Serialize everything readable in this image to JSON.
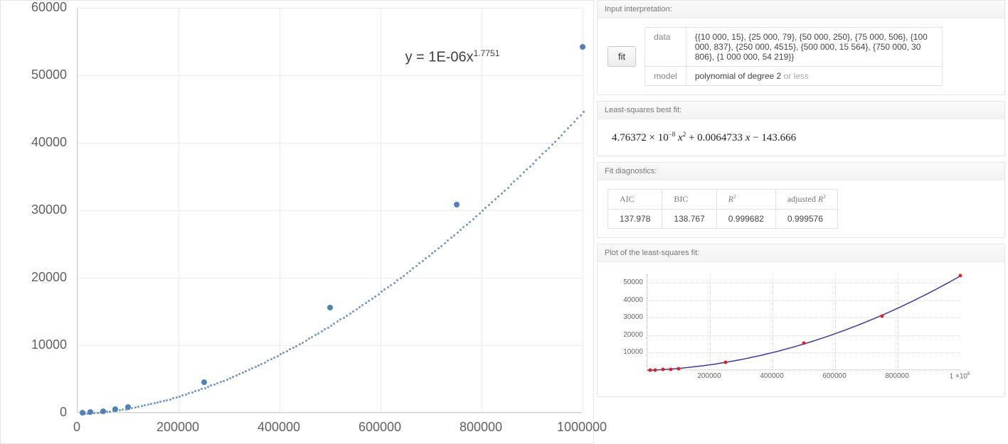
{
  "chart_data": {
    "type": "scatter",
    "title": "",
    "xlabel": "",
    "ylabel": "",
    "xlim": [
      0,
      1000000
    ],
    "ylim": [
      0,
      60000
    ],
    "x_ticks": [
      0,
      200000,
      400000,
      600000,
      800000,
      1000000
    ],
    "y_ticks": [
      0,
      10000,
      20000,
      30000,
      40000,
      50000,
      60000
    ],
    "series": [
      {
        "name": "data",
        "x": [
          10000,
          25000,
          50000,
          75000,
          100000,
          250000,
          500000,
          750000,
          1000000
        ],
        "y": [
          15,
          79,
          250,
          506,
          837,
          4515,
          15564,
          30806,
          54219
        ]
      }
    ],
    "trend": {
      "label": "y = 1E-06x^1.7751",
      "type": "power",
      "a": 1e-06,
      "b": 1.7751
    }
  },
  "equation_html": "y = 1E-06x<sup>1.7751</sup>",
  "input_interpretation": {
    "header": "Input interpretation:",
    "action_label": "fit",
    "rows": {
      "data_key": "data",
      "data_val": "{{10 000, 15}, {25 000, 79}, {50 000, 250}, {75 000, 506}, {100 000, 837}, {250 000, 4515}, {500 000, 15 564}, {750 000, 30 806}, {1 000 000, 54 219}}",
      "model_key": "model",
      "model_val": "polynomial of degree 2",
      "model_suffix": " or less"
    }
  },
  "best_fit": {
    "header": "Least-squares best fit:",
    "formula_html": "4.76372 × 10<sup>−8</sup> <i>x</i><sup>2</sup> + 0.0064733 <i>x</i> − 143.666"
  },
  "diagnostics": {
    "header": "Fit diagnostics:",
    "cols": [
      "AIC",
      "BIC",
      "R²",
      "adjusted R²"
    ],
    "vals": [
      "137.978",
      "138.767",
      "0.999682",
      "0.999576"
    ]
  },
  "mini_plot": {
    "header": "Plot of the least-squares fit:",
    "xlim": [
      0,
      1000000
    ],
    "ylim": [
      0,
      55000
    ],
    "y_ticks": [
      10000,
      20000,
      30000,
      40000,
      50000
    ],
    "x_ticks": [
      200000,
      400000,
      600000,
      800000
    ],
    "x_end_label": "1 ×10⁶",
    "points_x": [
      10000,
      25000,
      50000,
      75000,
      100000,
      250000,
      500000,
      750000,
      1000000
    ],
    "points_y": [
      15,
      79,
      250,
      506,
      837,
      4515,
      15564,
      30806,
      54219
    ],
    "fit": {
      "a": 4.76372e-08,
      "b": 0.0064733,
      "c": -143.666
    }
  }
}
